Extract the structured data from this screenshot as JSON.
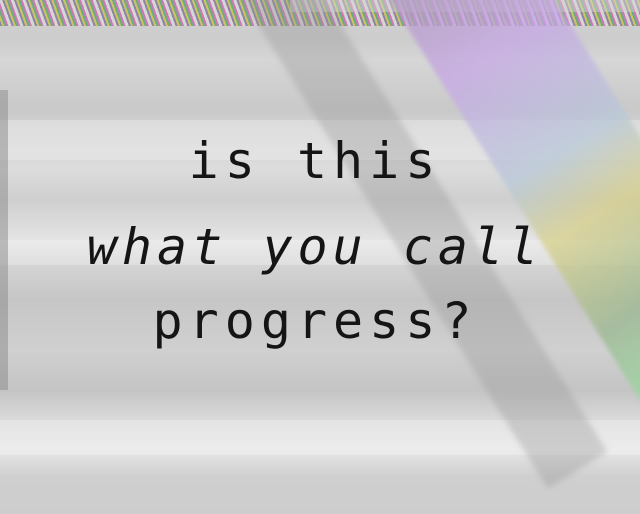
{
  "text": {
    "line1": "is this",
    "line2": "what you call",
    "line3": "progress?"
  },
  "colors": {
    "text": "#151515",
    "background": "#d0d0d0"
  }
}
